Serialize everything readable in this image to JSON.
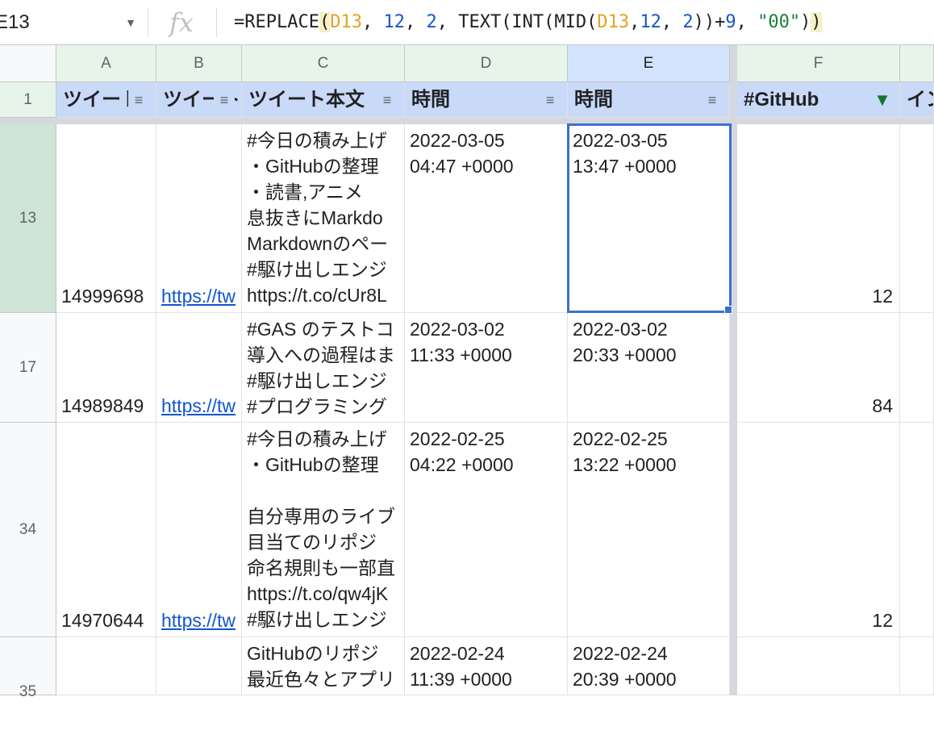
{
  "formula_bar": {
    "cell_ref": "E13",
    "fx_label": "fx",
    "formula_parts": {
      "p1": "=REPLACE",
      "p2": "(",
      "p3": "D13",
      "p4": ", ",
      "p5": "12",
      "p6": ", ",
      "p7": "2",
      "p8": ", TEXT(INT(MID(",
      "p9": "D13",
      "p10": ",",
      "p11": "12",
      "p12": ", ",
      "p13": "2",
      "p14": "))+",
      "p15": "9",
      "p16": ", ",
      "p17": "\"00\"",
      "p18": ")",
      "p19": ")"
    }
  },
  "columns": [
    "A",
    "B",
    "C",
    "D",
    "E",
    "F",
    ""
  ],
  "header_row": {
    "row_number": "1",
    "cells": [
      "ツイート",
      "ツイート",
      "ツイート本文",
      "時間",
      "時間",
      "#GitHub",
      "イン"
    ]
  },
  "rows": [
    {
      "row_number": "13",
      "a": "14999698",
      "b": "https://tw",
      "c": "#今日の積み上げ\n・GitHubの整理\n・読書,アニメ\n息抜きにMarkdo\nMarkdownのペー\n#駆け出しエンジ\nhttps://t.co/cUr8L",
      "d": "2022-03-05\n04:47 +0000",
      "e": "2022-03-05\n13:47 +0000",
      "f": "12"
    },
    {
      "row_number": "17",
      "a": "14989849",
      "b": "https://tw",
      "c": "#GAS のテストコ\n導入への過程はま\n#駆け出しエンジ\n#プログラミング",
      "d": "2022-03-02\n11:33 +0000",
      "e": "2022-03-02\n20:33 +0000",
      "f": "84"
    },
    {
      "row_number": "34",
      "a": "14970644",
      "b": "https://tw",
      "c": "#今日の積み上げ\n・GitHubの整理\n\n自分専用のライブ\n目当てのリポジ\n命名規則も一部直\nhttps://t.co/qw4jK\n#駆け出しエンジ",
      "d": "2022-02-25\n04:22 +0000",
      "e": "2022-02-25\n13:22 +0000",
      "f": "12"
    },
    {
      "row_number": "35",
      "a": "",
      "b": "",
      "c": "GitHubのリポジ\n最近色々とアプリ",
      "d": "2022-02-24\n11:39 +0000",
      "e": "2022-02-24\n20:39 +0000",
      "f": ""
    }
  ],
  "colors": {
    "header_fill": "#c9daf8",
    "selection": "#3b6fd4",
    "filter_active": "#137333",
    "link": "#1155cc"
  }
}
